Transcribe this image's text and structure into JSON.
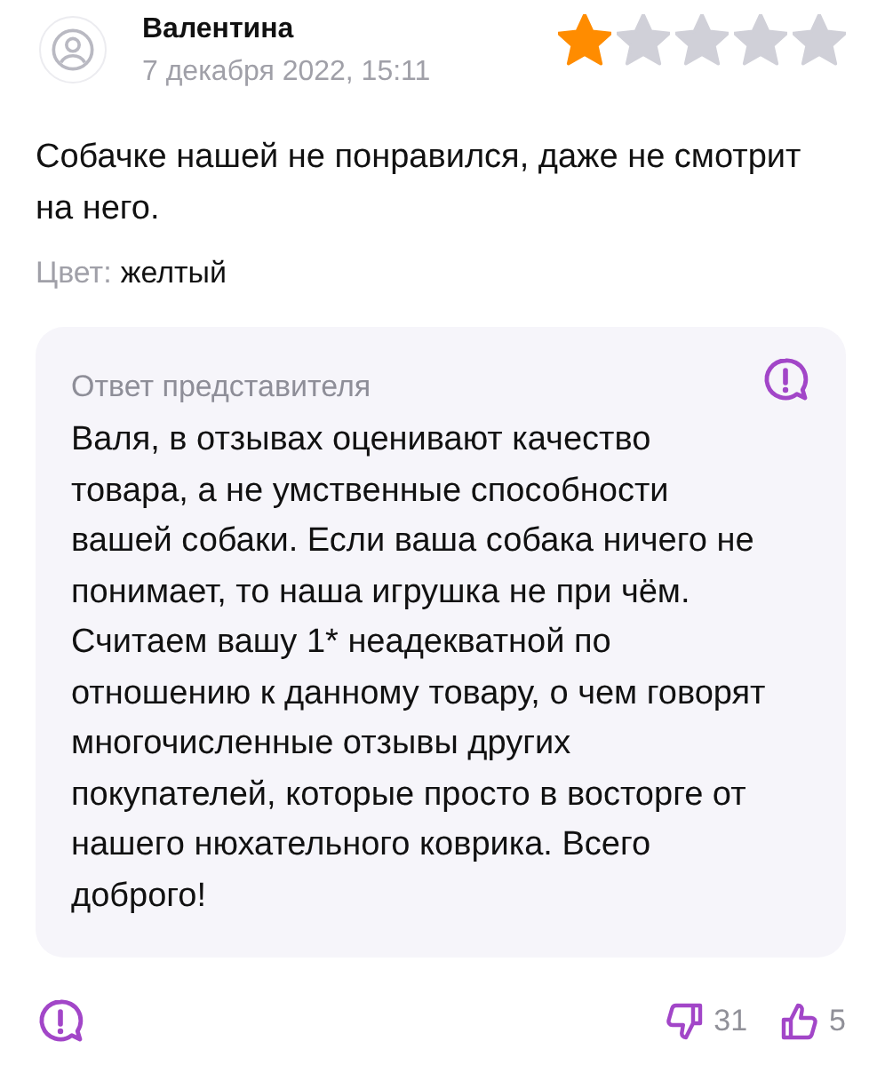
{
  "review": {
    "author": "Валентина",
    "date": "7 декабря 2022, 15:11",
    "stars": 1,
    "text": "Собачке нашей не понравился, даже не смотрит на него.",
    "attribute_label": "Цвет:",
    "attribute_value": "желтый"
  },
  "reply": {
    "title": "Ответ представителя",
    "text": "Валя, в отзывах оценивают качество товара, а не умственные способности вашей собаки. Если ваша собака ничего не понимает, то наша игрушка не при чём. Считаем вашу 1* неадекватной по отношению к данному товару, о чем говорят многочисленные отзывы других покупателей, которые просто в восторге от нашего нюхательного коврика. Всего доброго!"
  },
  "footer": {
    "dislikes": "31",
    "likes": "5"
  }
}
